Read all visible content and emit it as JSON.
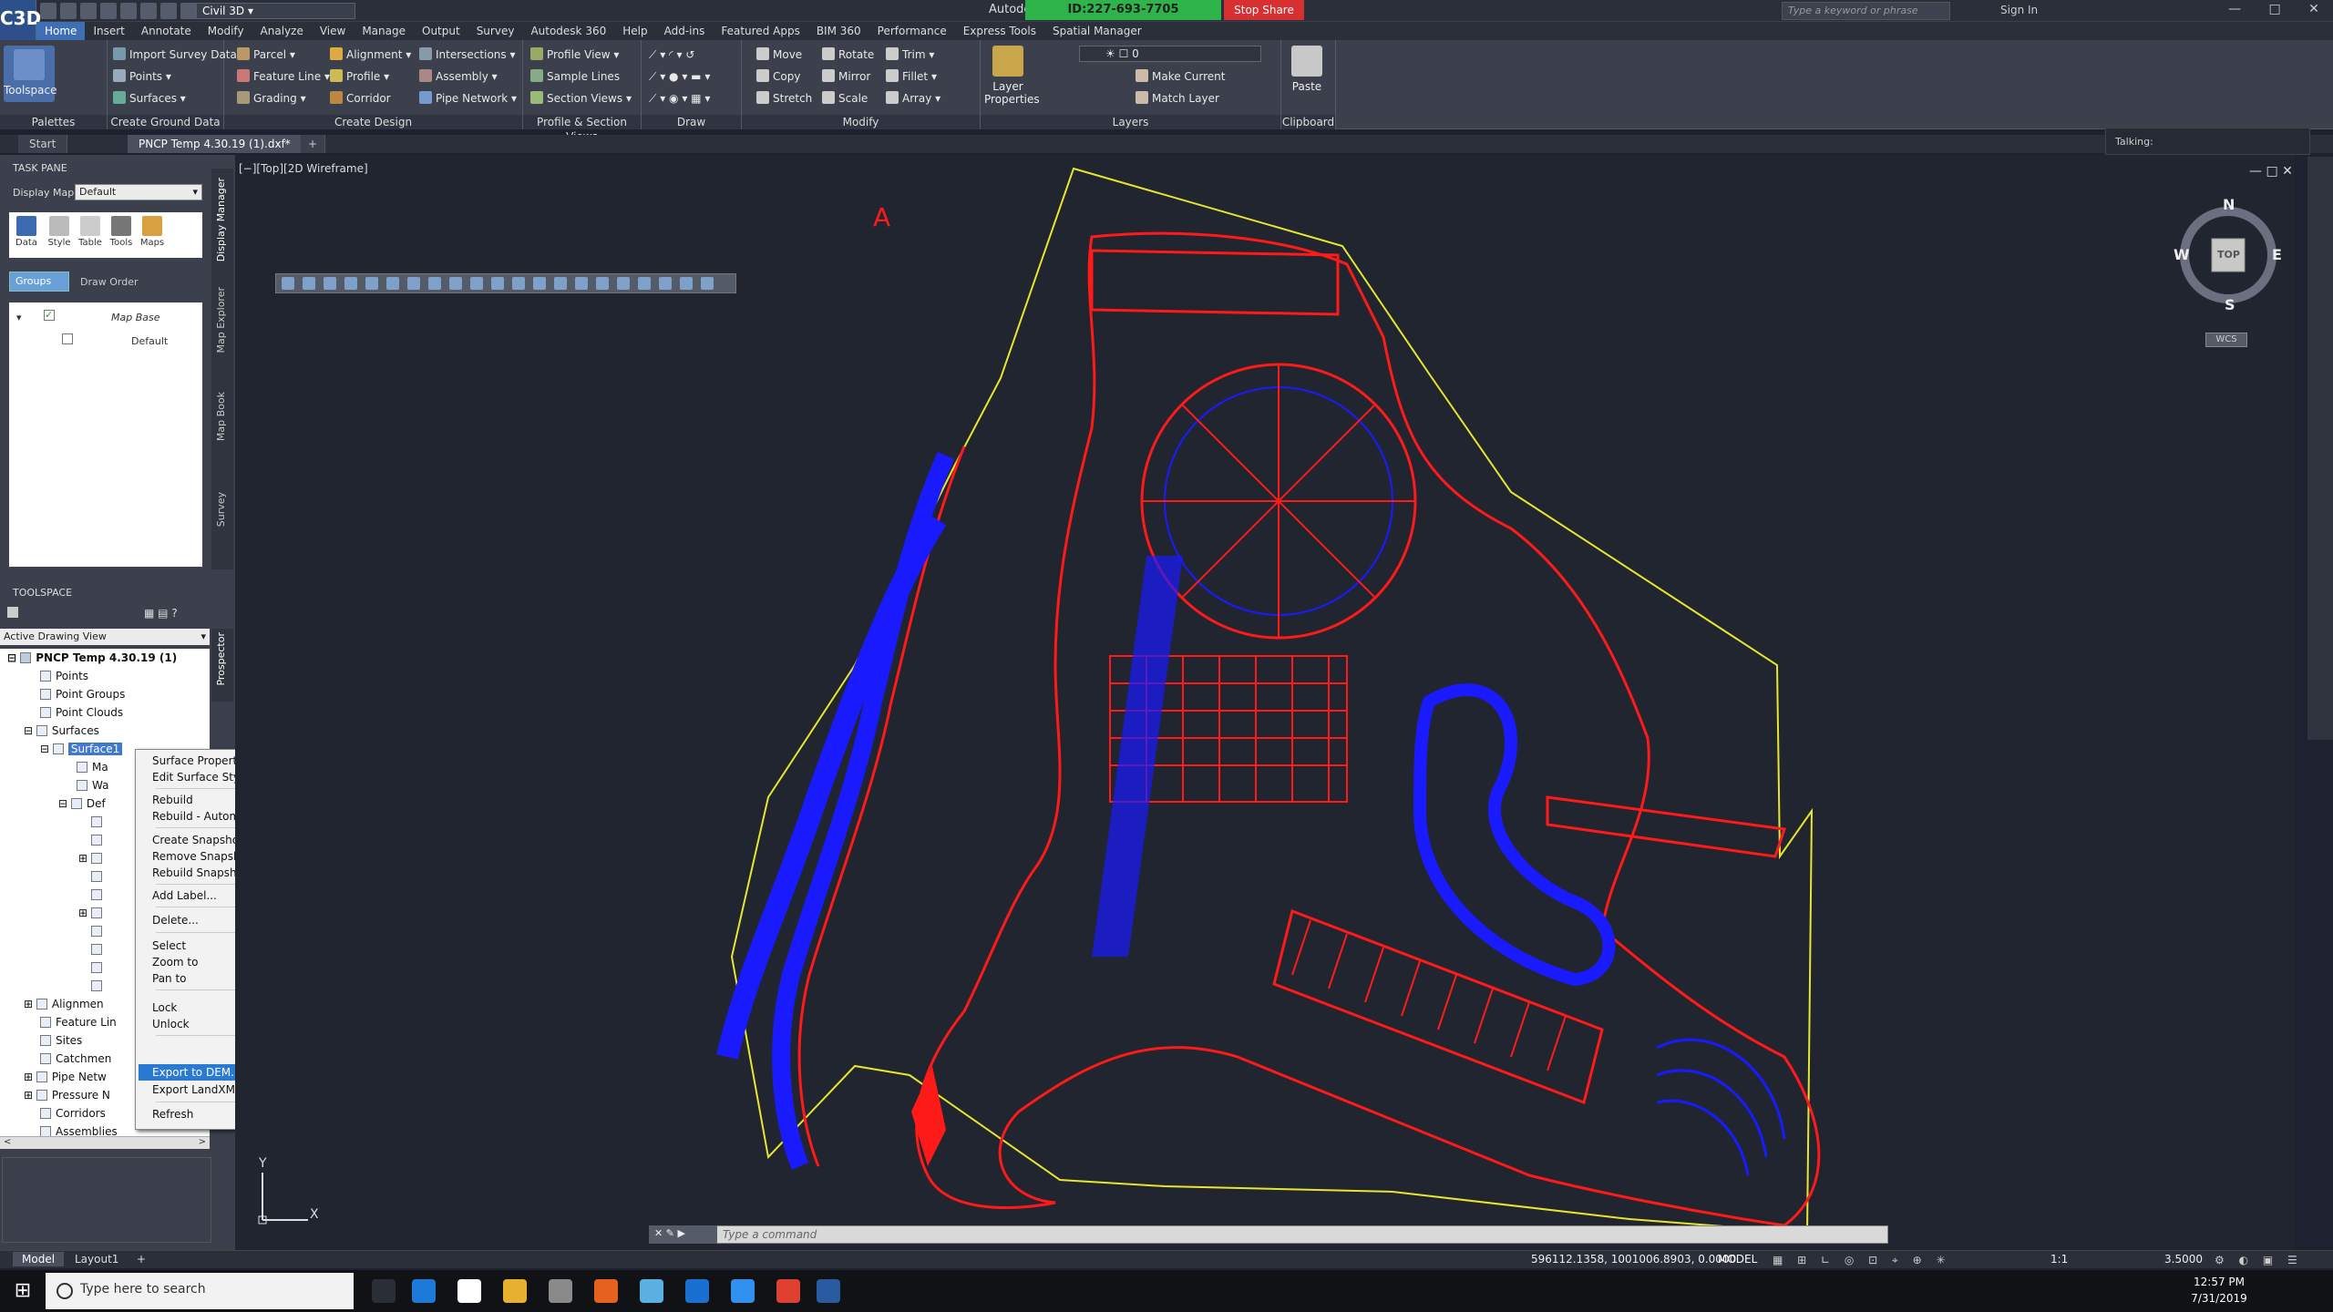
{
  "app": {
    "logo_text": "C3D",
    "workspace": "Civil 3D",
    "title_short": "Autode"
  },
  "share": {
    "id_text": "ID:227-693-7705",
    "stop_label": "Stop Share"
  },
  "search": {
    "placeholder": "Type a keyword or phrase"
  },
  "account": {
    "sign_in": "Sign In"
  },
  "menu": [
    "Home",
    "Insert",
    "Annotate",
    "Modify",
    "Analyze",
    "View",
    "Manage",
    "Output",
    "Survey",
    "Autodesk 360",
    "Help",
    "Add-ins",
    "Featured Apps",
    "BIM 360",
    "Performance",
    "Express Tools",
    "Spatial Manager"
  ],
  "ribbon": {
    "toolspace": "Toolspace",
    "palettes": "Palettes",
    "ground": {
      "import": "Import Survey Data",
      "points": "Points",
      "surfaces": "Surfaces",
      "title": "Create Ground Data"
    },
    "design": {
      "parcel": "Parcel",
      "feature_line": "Feature Line",
      "grading": "Grading",
      "alignment": "Alignment",
      "profile": "Profile",
      "corridor": "Corridor",
      "intersections": "Intersections",
      "assembly": "Assembly",
      "pipe_network": "Pipe Network",
      "title": "Create Design"
    },
    "profile": {
      "profile_view": "Profile View",
      "sample_lines": "Sample Lines",
      "section_views": "Section Views",
      "title": "Profile & Section Views"
    },
    "draw": {
      "title": "Draw"
    },
    "modify": {
      "move": "Move",
      "rotate": "Rotate",
      "trim": "Trim",
      "copy": "Copy",
      "mirror": "Mirror",
      "fillet": "Fillet",
      "stretch": "Stretch",
      "scale": "Scale",
      "array": "Array",
      "title": "Modify"
    },
    "layers": {
      "layer_props": "Layer Properties",
      "layer_value": "0",
      "make_current": "Make Current",
      "match_layer": "Match Layer",
      "title": "Layers"
    },
    "clipboard": {
      "paste": "Paste",
      "title": "Clipboard"
    }
  },
  "tabs": [
    "Start",
    "PNCP Temp 4.30.19 (1).dxf*"
  ],
  "talking": "Talking:",
  "taskpane": {
    "title": "TASK PANE",
    "display_map_label": "Display Map:",
    "display_map_value": "Default",
    "icons": [
      "Data",
      "Style",
      "Table",
      "Tools",
      "Maps"
    ],
    "groups": "Groups",
    "draw_order": "Draw Order",
    "map_base": "Map Base",
    "default": "Default",
    "vtabs": [
      "Display Manager",
      "Map Explorer",
      "Map Book",
      "Survey"
    ]
  },
  "toolspace": {
    "title": "TOOLSPACE",
    "view": "Active Drawing View",
    "prospector": "Prospector",
    "root": "PNCP Temp 4.30.19 (1)",
    "nodes": [
      "Points",
      "Point Groups",
      "Point Clouds",
      "Surfaces",
      "Surface1",
      "Ma",
      "Wa",
      "Def",
      "Alignmen",
      "Feature Lin",
      "Sites",
      "Catchmen",
      "Pipe Netw",
      "Pressure N",
      "Corridors",
      "Assemblies"
    ]
  },
  "context_menu": [
    "Surface Properties...",
    "Edit Surface Style...",
    "Rebuild",
    "Rebuild - Automatic",
    "Create Snapshot",
    "Remove Snapshot",
    "Rebuild Snapshot",
    "Add Label...",
    "Delete...",
    "Select",
    "Zoom to",
    "Pan to",
    "Lock",
    "Unlock",
    "Export to DEM...",
    "Export LandXML...",
    "Refresh"
  ],
  "viewport": {
    "label": "[−][Top][2D Wireframe]",
    "wcs": "WCS",
    "compass": {
      "n": "N",
      "s": "S",
      "e": "E",
      "w": "W",
      "top": "TOP"
    },
    "ucs_y": "Y",
    "ucs_x": "X"
  },
  "command": {
    "placeholder": "Type a command"
  },
  "layouts": [
    "Model",
    "Layout1"
  ],
  "status": {
    "coords": "596112.1358, 1001006.8903, 0.0000",
    "model": "MODEL",
    "scale": "1:1",
    "zoom": "3.5000"
  },
  "taskbar": {
    "search": "Type here to search",
    "time": "12:57 PM",
    "date": "7/31/2019"
  },
  "colors": {
    "accent": "#3f78d0",
    "linework_red": "#ff1a1a",
    "linework_blue": "#1a1aff",
    "boundary_yellow": "#e6e62e"
  }
}
